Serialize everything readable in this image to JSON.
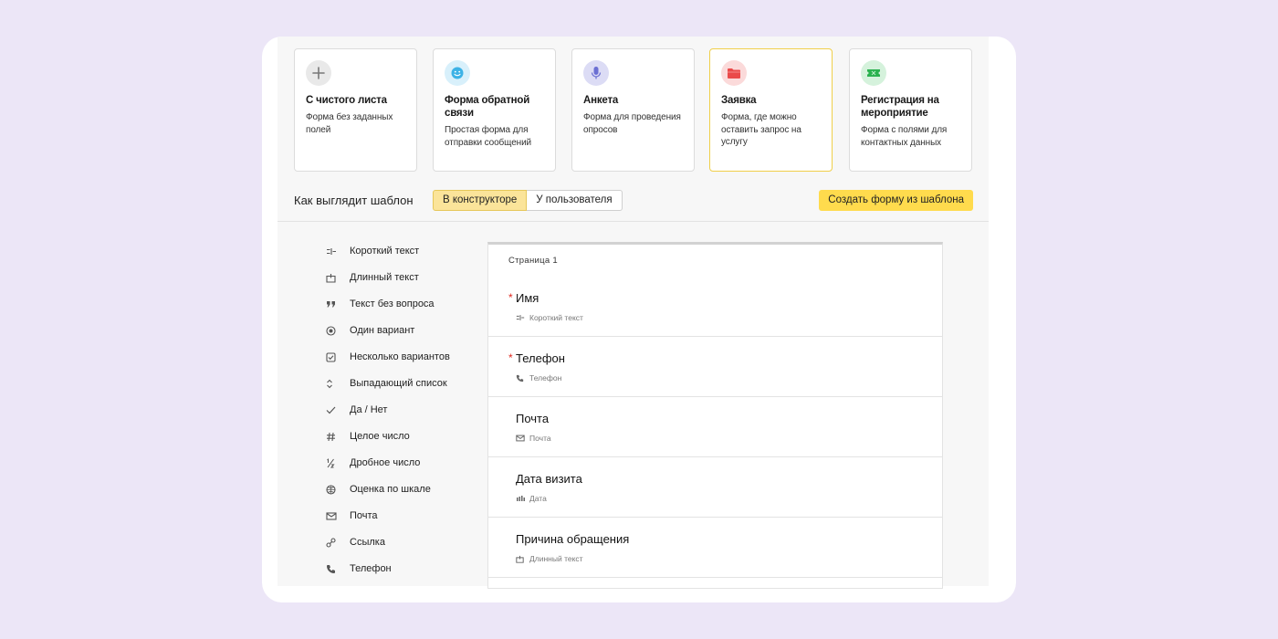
{
  "cards": [
    {
      "title": "С чистого листа",
      "description": "Форма без заданных полей",
      "icon": "plus-icon",
      "icon_bg": "#e9e9e9",
      "icon_color": "#777777",
      "selected": false
    },
    {
      "title": "Форма обратной связи",
      "description": "Простая форма для отправки сообщений",
      "icon": "smiley-icon",
      "icon_bg": "#d8f0fb",
      "icon_color": "#3cb2e6",
      "selected": false
    },
    {
      "title": "Анкета",
      "description": "Форма для проведения опросов",
      "icon": "microphone-icon",
      "icon_bg": "#dcdcf5",
      "icon_color": "#6b6fd3",
      "selected": false
    },
    {
      "title": "Заявка",
      "description": "Форма, где можно оставить запрос на услугу",
      "icon": "folder-icon",
      "icon_bg": "#fbdada",
      "icon_color": "#ea4a4a",
      "selected": true
    },
    {
      "title": "Регистрация на мероприятие",
      "description": "Форма с полями для контактных данных",
      "icon": "ticket-icon",
      "icon_bg": "#d5f2dc",
      "icon_color": "#2bb14f",
      "selected": false
    }
  ],
  "toolbar": {
    "preview_label": "Как выглядит шаблон",
    "view_constructor": "В конструкторе",
    "view_user": "У пользователя",
    "create_button": "Создать форму из шаблона",
    "accent": "#ffdb4d"
  },
  "field_types": [
    {
      "label": "Короткий текст",
      "icon": "short-text-icon"
    },
    {
      "label": "Длинный текст",
      "icon": "long-text-icon"
    },
    {
      "label": "Текст без вопроса",
      "icon": "quote-icon"
    },
    {
      "label": "Один вариант",
      "icon": "radio-icon"
    },
    {
      "label": "Несколько вариантов",
      "icon": "checkbox-icon"
    },
    {
      "label": "Выпадающий список",
      "icon": "dropdown-icon"
    },
    {
      "label": "Да / Нет",
      "icon": "check-icon"
    },
    {
      "label": "Целое число",
      "icon": "hash-icon"
    },
    {
      "label": "Дробное число",
      "icon": "fraction-icon"
    },
    {
      "label": "Оценка по шкале",
      "icon": "scale-icon"
    },
    {
      "label": "Почта",
      "icon": "mail-icon"
    },
    {
      "label": "Ссылка",
      "icon": "link-icon"
    },
    {
      "label": "Телефон",
      "icon": "phone-icon"
    }
  ],
  "form": {
    "page_label": "Страница 1",
    "required_mark": "*",
    "questions": [
      {
        "title": "Имя",
        "type_label": "Короткий текст",
        "type_icon": "short-text-icon",
        "required": true
      },
      {
        "title": "Телефон",
        "type_label": "Телефон",
        "type_icon": "phone-icon",
        "required": true
      },
      {
        "title": "Почта",
        "type_label": "Почта",
        "type_icon": "mail-icon",
        "required": false
      },
      {
        "title": "Дата визита",
        "type_label": "Дата",
        "type_icon": "date-icon",
        "required": false
      },
      {
        "title": "Причина обращения",
        "type_label": "Длинный текст",
        "type_icon": "long-text-icon",
        "required": false
      }
    ]
  }
}
